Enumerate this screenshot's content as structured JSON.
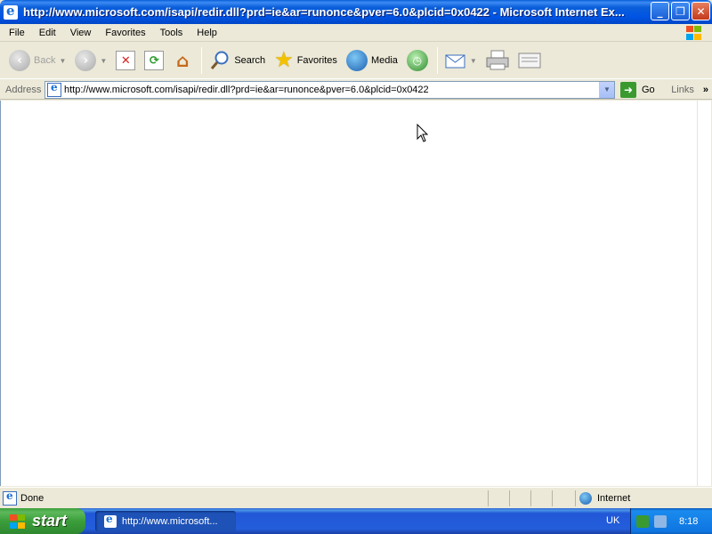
{
  "window": {
    "title": "http://www.microsoft.com/isapi/redir.dll?prd=ie&ar=runonce&pver=6.0&plcid=0x0422 - Microsoft Internet Ex...",
    "buttons": [
      "minimize",
      "restore",
      "close"
    ]
  },
  "menubar": {
    "items": [
      "File",
      "Edit",
      "View",
      "Favorites",
      "Tools",
      "Help"
    ]
  },
  "toolbar": {
    "back_label": "Back",
    "search_label": "Search",
    "favorites_label": "Favorites",
    "media_label": "Media"
  },
  "address": {
    "label": "Address",
    "url": "http://www.microsoft.com/isapi/redir.dll?prd=ie&ar=runonce&pver=6.0&plcid=0x0422",
    "go_label": "Go",
    "links_label": "Links"
  },
  "statusbar": {
    "status_text": "Done",
    "zone_label": "Internet"
  },
  "taskbar": {
    "start_label": "start",
    "task_label": "http://www.microsoft...",
    "language": "UK",
    "clock": "8:18"
  },
  "colors": {
    "titlebar": "#0054e3",
    "taskbar": "#245edb",
    "start": "#3b9e3b",
    "chrome": "#ece9d8"
  }
}
